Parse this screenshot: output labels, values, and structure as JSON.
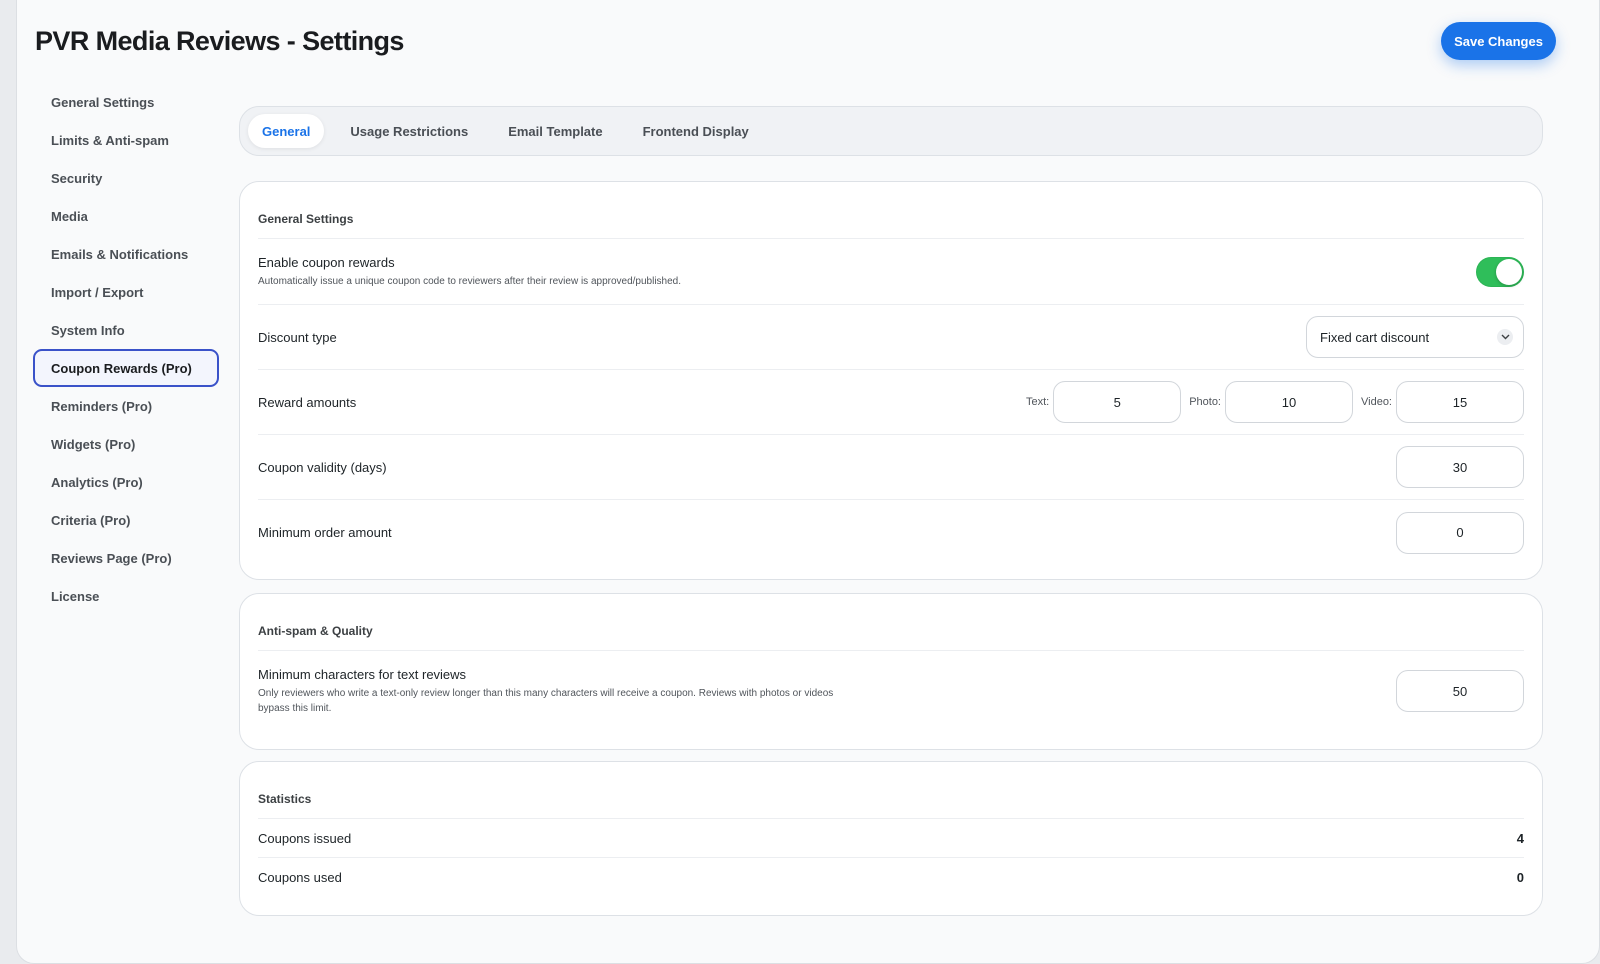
{
  "page": {
    "title": "PVR Media Reviews - Settings",
    "save_label": "Save Changes"
  },
  "sidebar": {
    "items": [
      {
        "label": "General Settings"
      },
      {
        "label": "Limits & Anti-spam"
      },
      {
        "label": "Security"
      },
      {
        "label": "Media"
      },
      {
        "label": "Emails & Notifications"
      },
      {
        "label": "Import / Export"
      },
      {
        "label": "System Info"
      },
      {
        "label": "Coupon Rewards (Pro)",
        "active": true
      },
      {
        "label": "Reminders (Pro)"
      },
      {
        "label": "Widgets (Pro)"
      },
      {
        "label": "Analytics (Pro)"
      },
      {
        "label": "Criteria (Pro)"
      },
      {
        "label": "Reviews Page (Pro)"
      },
      {
        "label": "License"
      }
    ]
  },
  "tabs": [
    {
      "label": "General",
      "active": true
    },
    {
      "label": "Usage Restrictions"
    },
    {
      "label": "Email Template"
    },
    {
      "label": "Frontend Display"
    }
  ],
  "general": {
    "title": "General Settings",
    "enable": {
      "label": "Enable coupon rewards",
      "description": "Automatically issue a unique coupon code to reviewers after their review is approved/published.",
      "enabled": true
    },
    "discount_type": {
      "label": "Discount type",
      "value": "Fixed cart discount"
    },
    "reward_amounts": {
      "label": "Reward amounts",
      "text_label": "Text:",
      "text_value": "5",
      "photo_label": "Photo:",
      "photo_value": "10",
      "video_label": "Video:",
      "video_value": "15"
    },
    "validity": {
      "label": "Coupon validity (days)",
      "value": "30"
    },
    "min_order": {
      "label": "Minimum order amount",
      "value": "0"
    }
  },
  "antispam": {
    "title": "Anti-spam & Quality",
    "min_chars": {
      "label": "Minimum characters for text reviews",
      "description_line1": "Only reviewers who write a text-only review longer than this many characters will receive a coupon. Reviews with photos or videos",
      "description_line2": "bypass this limit.",
      "value": "50"
    }
  },
  "statistics": {
    "title": "Statistics",
    "issued": {
      "label": "Coupons issued",
      "value": "4"
    },
    "used": {
      "label": "Coupons used",
      "value": "0"
    }
  },
  "colors": {
    "accent": "#1a73e8",
    "toggle_on": "#2fbe5a",
    "active_border": "#3a52c9"
  },
  "icons": {
    "dropdown": "chevron-down-icon"
  }
}
